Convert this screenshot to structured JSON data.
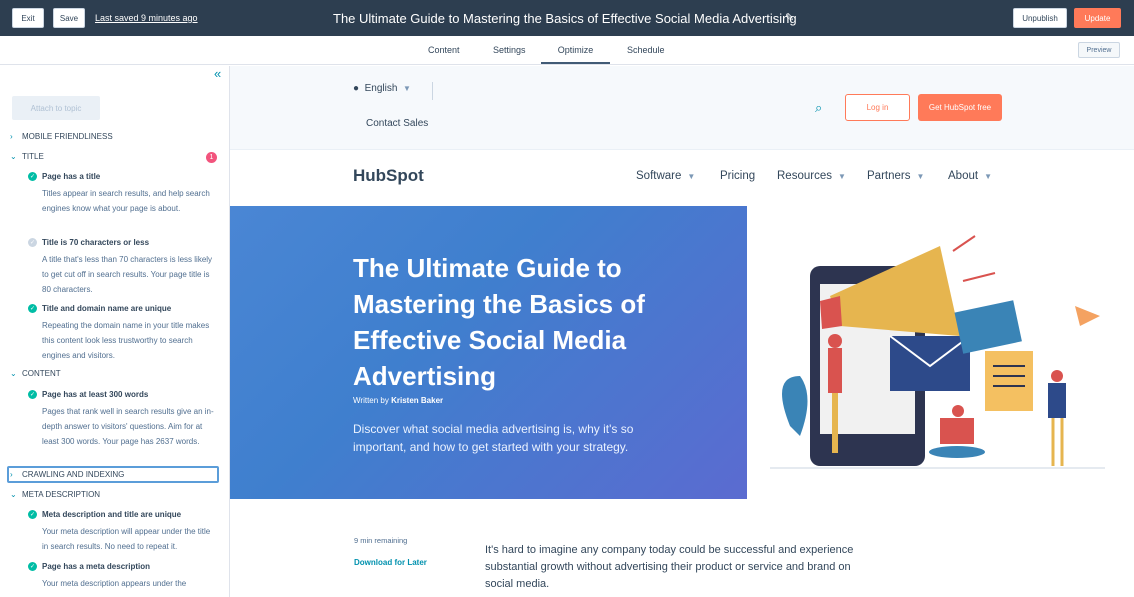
{
  "topbar": {
    "exit_label": "Exit",
    "save_label": "Save",
    "last_saved": "Last saved 9 minutes ago",
    "page_title": "The Ultimate Guide to Mastering the Basics of Effective Social Media Advertising",
    "unpublish_label": "Unpublish",
    "update_label": "Update"
  },
  "tabs": [
    {
      "label": "Content"
    },
    {
      "label": "Settings"
    },
    {
      "label": "Optimize",
      "active": true
    },
    {
      "label": "Schedule"
    }
  ],
  "preview_label": "Preview",
  "sidebar": {
    "attach_label": "Attach to topic",
    "sections": {
      "mobile": "MOBILE FRIENDLINESS",
      "title": "TITLE",
      "title_badge": "1",
      "content": "CONTENT",
      "crawling": "CRAWLING AND INDEXING",
      "meta": "META DESCRIPTION"
    },
    "checks": [
      {
        "title": "Page has a title",
        "desc": "Titles appear in search results, and help search engines know what your page is about.",
        "status": "pass"
      },
      {
        "title": "Title is 70 characters or less",
        "desc": "A title that's less than 70 characters is less likely to get cut off in search results. Your page title is 80 characters.",
        "status": "fail"
      },
      {
        "title": "Title and domain name are unique",
        "desc": "Repeating the domain name in your title makes this content look less trustworthy to search engines and visitors.",
        "status": "pass"
      },
      {
        "title": "Page has at least 300 words",
        "desc": "Pages that rank well in search results give an in-depth answer to visitors' questions. Aim for at least 300 words. Your page has 2637 words.",
        "status": "pass"
      },
      {
        "title": "Meta description and title are unique",
        "desc": "Your meta description will appear under the title in search results. No need to repeat it.",
        "status": "pass"
      },
      {
        "title": "Page has a meta description",
        "desc": "Your meta description appears under the",
        "status": "pass"
      }
    ]
  },
  "site": {
    "language": "English",
    "contact": "Contact Sales",
    "login": "Log in",
    "get_free": "Get HubSpot free",
    "logo": "HubSpot",
    "nav": [
      "Software",
      "Pricing",
      "Resources",
      "Partners",
      "About"
    ]
  },
  "hero": {
    "title": "The Ultimate Guide to Mastering the Basics of Effective Social Media Advertising",
    "author_prefix": "Written by",
    "author": "Kristen Baker",
    "subtitle": "Discover what social media advertising is, why it's so important, and how to get started with your strategy."
  },
  "article": {
    "remaining": "9 min remaining",
    "download": "Download for Later",
    "body": "It's hard to imagine any company today could be successful and experience substantial growth without advertising their product or service and brand on social media."
  }
}
